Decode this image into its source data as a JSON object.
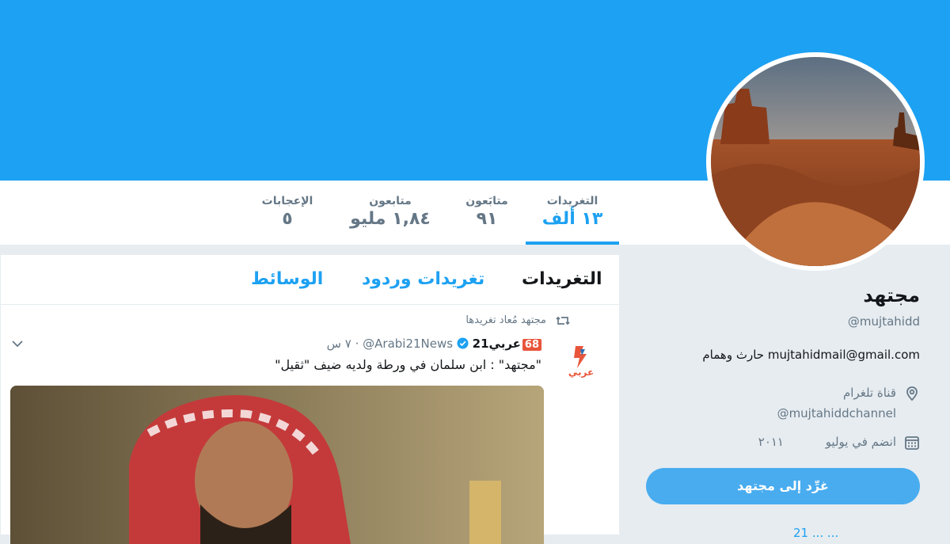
{
  "profile": {
    "name": "مجتهد",
    "handle": "@mujtahidd",
    "bio": "mujtahidmail@gmail.com حارث وهمام",
    "location_label": "قناة تلغرام",
    "location_value": "@mujtahiddchannel",
    "joined": "انضم في يوليو",
    "joined_year": "٢٠١١",
    "follow_label": "غرِّد إلى مجتهد",
    "more_row": "21 ... ..."
  },
  "stats": [
    {
      "label": "التغريدات",
      "value": "١٣ ألف"
    },
    {
      "label": "متابَعون",
      "value": "٩١"
    },
    {
      "label": "متابعون",
      "value": "١,٨٤ مليو"
    },
    {
      "label": "الإعجابات",
      "value": "٥"
    }
  ],
  "tabs": [
    "التغريدات",
    "تغريدات وردود",
    "الوسائط"
  ],
  "tweet": {
    "retweet_note": "مجتهد مُعاد تغريدها",
    "display_name": "عربي21",
    "badge": "68",
    "handle": "@Arabi21News",
    "time": "· ٧ س",
    "text": "\"مجتهد\" : ابن سلمان في ورطة ولديه ضيف \"ثقيل\"",
    "avatar_text": "عربي"
  },
  "colors": {
    "brand": "#1da1f2",
    "text": "#14171a",
    "muted": "#657786",
    "background": "#e6ecf0"
  },
  "icons": [
    "location-icon",
    "calendar-icon",
    "retweet-icon",
    "verified-icon",
    "chevron-down-icon"
  ]
}
